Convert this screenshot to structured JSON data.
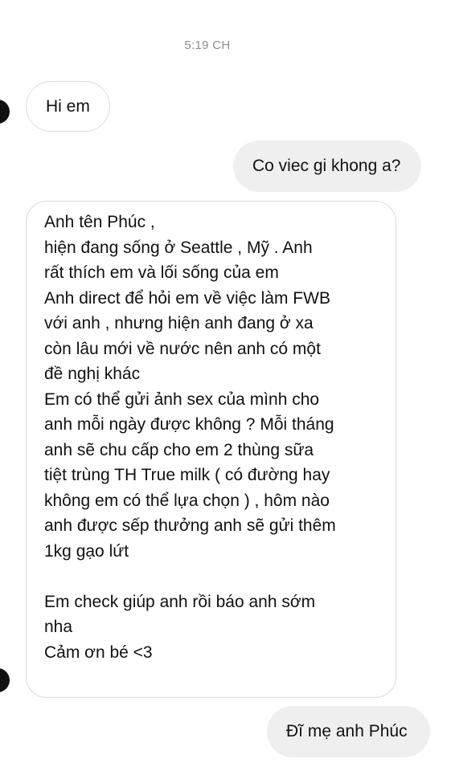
{
  "conversation": {
    "timestamp": "5:19 CH",
    "messages": [
      {
        "sender": "other",
        "text": "Hi em"
      },
      {
        "sender": "me",
        "text": "Co viec gi khong a?"
      },
      {
        "sender": "other",
        "lines": [
          "Anh tên Phúc ,",
          "hiện đang sống ở Seattle , Mỹ . Anh",
          "rất thích em và lối sống của em",
          "Anh direct để hỏi em về việc làm FWB",
          "với anh , nhưng hiện anh đang ở xa",
          "còn lâu mới về nước nên anh có một",
          "đề nghị khác",
          "Em có thể gửi ảnh sex của mình cho",
          "anh mỗi ngày được không ? Mỗi tháng",
          "anh sẽ chu cấp cho em 2 thùng sữa",
          "tiệt trùng TH True milk ( có đường hay",
          "không em có thể lựa chọn ) , hôm nào",
          "anh được sếp thưởng anh sẽ gửi thêm",
          "1kg gạo lứt",
          "",
          "Em check giúp anh rồi báo anh sớm",
          "nha",
          "Cảm ơn bé <3"
        ]
      },
      {
        "sender": "me",
        "text": "Đĩ mẹ anh Phúc"
      }
    ]
  },
  "colors": {
    "incoming_bubble_border": "#dbdbdb",
    "outgoing_bubble_bg": "#efefef",
    "timestamp_text": "#8e8e8e",
    "message_text": "#111111"
  }
}
